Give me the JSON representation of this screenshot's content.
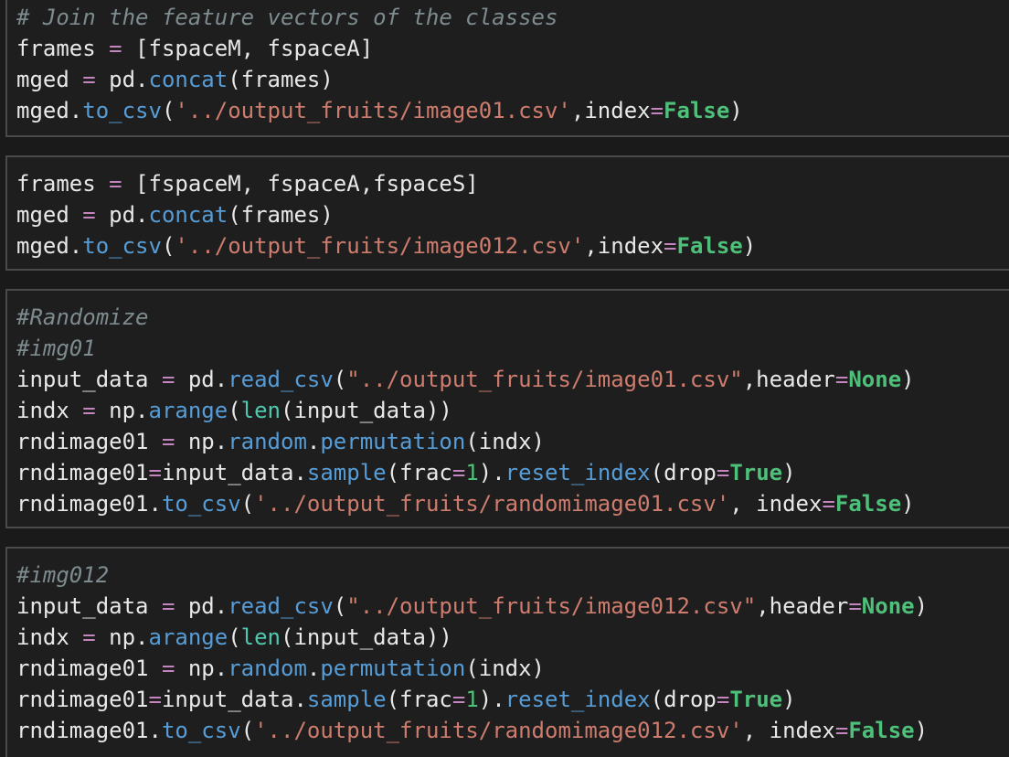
{
  "cells": [
    {
      "id": "cell-1",
      "lines": [
        [
          {
            "t": "# Join the feature vectors of the classes",
            "c": "com2"
          }
        ],
        [
          {
            "t": "frames ",
            "c": "var"
          },
          {
            "t": "=",
            "c": "op"
          },
          {
            "t": " [fspaceM, fspaceA]",
            "c": "var"
          }
        ],
        [
          {
            "t": "mged ",
            "c": "var"
          },
          {
            "t": "=",
            "c": "op"
          },
          {
            "t": " pd.",
            "c": "var"
          },
          {
            "t": "concat",
            "c": "fn"
          },
          {
            "t": "(frames)",
            "c": "var"
          }
        ],
        [
          {
            "t": "mged.",
            "c": "var"
          },
          {
            "t": "to_csv",
            "c": "fn"
          },
          {
            "t": "(",
            "c": "var"
          },
          {
            "t": "'../output_fruits/image01.csv'",
            "c": "str"
          },
          {
            "t": ",index",
            "c": "var"
          },
          {
            "t": "=",
            "c": "op"
          },
          {
            "t": "False",
            "c": "kw"
          },
          {
            "t": ")",
            "c": "var"
          }
        ]
      ]
    },
    {
      "id": "cell-2",
      "lines": [
        [
          {
            "t": "frames ",
            "c": "var"
          },
          {
            "t": "=",
            "c": "op"
          },
          {
            "t": " [fspaceM, fspaceA,fspaceS]",
            "c": "var"
          }
        ],
        [
          {
            "t": "mged ",
            "c": "var"
          },
          {
            "t": "=",
            "c": "op"
          },
          {
            "t": " pd.",
            "c": "var"
          },
          {
            "t": "concat",
            "c": "fn"
          },
          {
            "t": "(frames)",
            "c": "var"
          }
        ],
        [
          {
            "t": "mged.",
            "c": "var"
          },
          {
            "t": "to_csv",
            "c": "fn"
          },
          {
            "t": "(",
            "c": "var"
          },
          {
            "t": "'../output_fruits/image012.csv'",
            "c": "str"
          },
          {
            "t": ",index",
            "c": "var"
          },
          {
            "t": "=",
            "c": "op"
          },
          {
            "t": "False",
            "c": "kw"
          },
          {
            "t": ")",
            "c": "var"
          }
        ]
      ]
    },
    {
      "id": "cell-3",
      "lines": [
        [
          {
            "t": "#Randomize",
            "c": "com2"
          }
        ],
        [
          {
            "t": "#img01",
            "c": "com2"
          }
        ],
        [
          {
            "t": "input_data ",
            "c": "var"
          },
          {
            "t": "=",
            "c": "op"
          },
          {
            "t": " pd.",
            "c": "var"
          },
          {
            "t": "read_csv",
            "c": "fn"
          },
          {
            "t": "(",
            "c": "var"
          },
          {
            "t": "\"../output_fruits/image01.csv\"",
            "c": "str"
          },
          {
            "t": ",header",
            "c": "var"
          },
          {
            "t": "=",
            "c": "op"
          },
          {
            "t": "None",
            "c": "kw"
          },
          {
            "t": ")",
            "c": "var"
          }
        ],
        [
          {
            "t": "indx ",
            "c": "var"
          },
          {
            "t": "=",
            "c": "op"
          },
          {
            "t": " np.",
            "c": "var"
          },
          {
            "t": "arange",
            "c": "fn"
          },
          {
            "t": "(",
            "c": "var"
          },
          {
            "t": "len",
            "c": "builtin"
          },
          {
            "t": "(input_data))",
            "c": "var"
          }
        ],
        [
          {
            "t": "rndimage01 ",
            "c": "var"
          },
          {
            "t": "=",
            "c": "op"
          },
          {
            "t": " np.",
            "c": "var"
          },
          {
            "t": "random",
            "c": "fn"
          },
          {
            "t": ".",
            "c": "var"
          },
          {
            "t": "permutation",
            "c": "fn"
          },
          {
            "t": "(indx)",
            "c": "var"
          }
        ],
        [
          {
            "t": "rndimage01",
            "c": "var"
          },
          {
            "t": "=",
            "c": "op"
          },
          {
            "t": "input_data.",
            "c": "var"
          },
          {
            "t": "sample",
            "c": "fn"
          },
          {
            "t": "(frac",
            "c": "var"
          },
          {
            "t": "=",
            "c": "op"
          },
          {
            "t": "1",
            "c": "num"
          },
          {
            "t": ").",
            "c": "var"
          },
          {
            "t": "reset_index",
            "c": "fn"
          },
          {
            "t": "(drop",
            "c": "var"
          },
          {
            "t": "=",
            "c": "op"
          },
          {
            "t": "True",
            "c": "kw"
          },
          {
            "t": ")",
            "c": "var"
          }
        ],
        [
          {
            "t": "rndimage01.",
            "c": "var"
          },
          {
            "t": "to_csv",
            "c": "fn"
          },
          {
            "t": "(",
            "c": "var"
          },
          {
            "t": "'../output_fruits/randomimage01.csv'",
            "c": "str"
          },
          {
            "t": ", index",
            "c": "var"
          },
          {
            "t": "=",
            "c": "op"
          },
          {
            "t": "False",
            "c": "kw"
          },
          {
            "t": ")",
            "c": "var"
          }
        ]
      ]
    },
    {
      "id": "cell-4",
      "lines": [
        [
          {
            "t": "#img012",
            "c": "com2"
          }
        ],
        [
          {
            "t": "input_data ",
            "c": "var"
          },
          {
            "t": "=",
            "c": "op"
          },
          {
            "t": " pd.",
            "c": "var"
          },
          {
            "t": "read_csv",
            "c": "fn"
          },
          {
            "t": "(",
            "c": "var"
          },
          {
            "t": "\"../output_fruits/image012.csv\"",
            "c": "str"
          },
          {
            "t": ",header",
            "c": "var"
          },
          {
            "t": "=",
            "c": "op"
          },
          {
            "t": "None",
            "c": "kw"
          },
          {
            "t": ")",
            "c": "var"
          }
        ],
        [
          {
            "t": "indx ",
            "c": "var"
          },
          {
            "t": "=",
            "c": "op"
          },
          {
            "t": " np.",
            "c": "var"
          },
          {
            "t": "arange",
            "c": "fn"
          },
          {
            "t": "(",
            "c": "var"
          },
          {
            "t": "len",
            "c": "builtin"
          },
          {
            "t": "(input_data))",
            "c": "var"
          }
        ],
        [
          {
            "t": "rndimage01 ",
            "c": "var"
          },
          {
            "t": "=",
            "c": "op"
          },
          {
            "t": " np.",
            "c": "var"
          },
          {
            "t": "random",
            "c": "fn"
          },
          {
            "t": ".",
            "c": "var"
          },
          {
            "t": "permutation",
            "c": "fn"
          },
          {
            "t": "(indx)",
            "c": "var"
          }
        ],
        [
          {
            "t": "rndimage01",
            "c": "var"
          },
          {
            "t": "=",
            "c": "op"
          },
          {
            "t": "input_data.",
            "c": "var"
          },
          {
            "t": "sample",
            "c": "fn"
          },
          {
            "t": "(frac",
            "c": "var"
          },
          {
            "t": "=",
            "c": "op"
          },
          {
            "t": "1",
            "c": "num"
          },
          {
            "t": ").",
            "c": "var"
          },
          {
            "t": "reset_index",
            "c": "fn"
          },
          {
            "t": "(drop",
            "c": "var"
          },
          {
            "t": "=",
            "c": "op"
          },
          {
            "t": "True",
            "c": "kw"
          },
          {
            "t": ")",
            "c": "var"
          }
        ],
        [
          {
            "t": "rndimage01.",
            "c": "var"
          },
          {
            "t": "to_csv",
            "c": "fn"
          },
          {
            "t": "(",
            "c": "var"
          },
          {
            "t": "'../output_fruits/randomimage012.csv'",
            "c": "str"
          },
          {
            "t": ", index",
            "c": "var"
          },
          {
            "t": "=",
            "c": "op"
          },
          {
            "t": "False",
            "c": "kw"
          },
          {
            "t": ")",
            "c": "var"
          }
        ]
      ]
    }
  ]
}
